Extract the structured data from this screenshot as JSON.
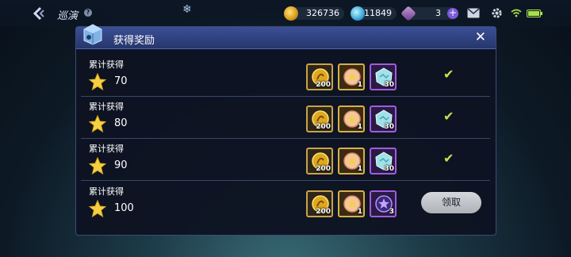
{
  "header": {
    "title": "巡演",
    "help_icon": "?",
    "resources": [
      {
        "icon": "gold-coin-icon",
        "value": "326736"
      },
      {
        "icon": "gem-icon",
        "value": "11849"
      },
      {
        "icon": "ticket-icon",
        "value": "3"
      }
    ]
  },
  "dialog": {
    "title": "获得奖励",
    "close_label": "✕",
    "rows": [
      {
        "label": "累计获得",
        "count": "70",
        "rewards": [
          {
            "type": "gold",
            "qty": "200"
          },
          {
            "type": "coin",
            "qty": "1"
          },
          {
            "type": "crystal",
            "qty": "30"
          }
        ],
        "status": "claimed"
      },
      {
        "label": "累计获得",
        "count": "80",
        "rewards": [
          {
            "type": "gold",
            "qty": "200"
          },
          {
            "type": "coin",
            "qty": "1"
          },
          {
            "type": "crystal",
            "qty": "30"
          }
        ],
        "status": "claimed"
      },
      {
        "label": "累计获得",
        "count": "90",
        "rewards": [
          {
            "type": "gold",
            "qty": "200"
          },
          {
            "type": "coin",
            "qty": "1"
          },
          {
            "type": "crystal",
            "qty": "30"
          }
        ],
        "status": "claimed"
      },
      {
        "label": "累计获得",
        "count": "100",
        "rewards": [
          {
            "type": "gold",
            "qty": "200"
          },
          {
            "type": "coin",
            "qty": "1"
          },
          {
            "type": "star-orb",
            "qty": "3"
          }
        ],
        "status": "claimable",
        "claim_label": "领取"
      }
    ]
  },
  "colors": {
    "accent": "#c6e34a",
    "panel_header": "#3a4f95",
    "purple_frame": "#a05be0",
    "gold_frame": "#d7b04a"
  }
}
